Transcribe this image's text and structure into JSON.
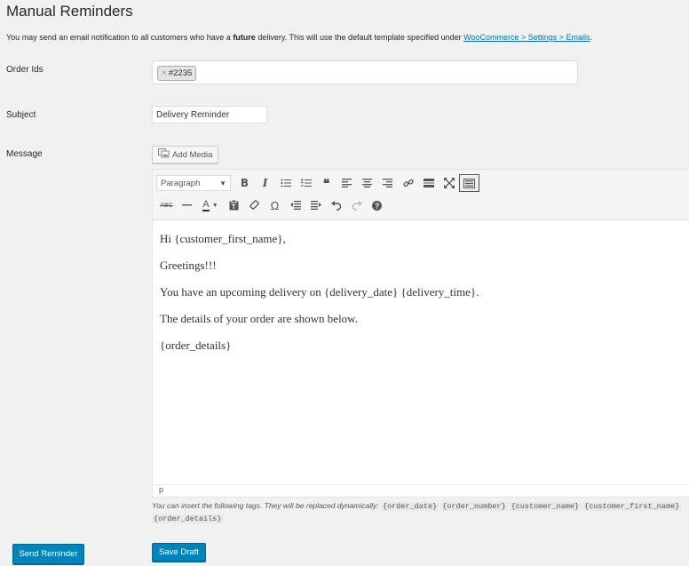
{
  "page": {
    "title": "Manual Reminders",
    "intro_prefix": "You may send an email notification to all customers who have a ",
    "intro_bold": "future",
    "intro_middle": " delivery. This will use the default template specified under ",
    "intro_link": "WooCommerce > Settings > Emails",
    "intro_suffix": "."
  },
  "form": {
    "order_ids_label": "Order Ids",
    "order_ids": [
      {
        "remove": "×",
        "value": "#2235"
      }
    ],
    "subject_label": "Subject",
    "subject_value": "Delivery Reminder",
    "message_label": "Message",
    "add_media_label": "Add Media"
  },
  "editor": {
    "format_select": "Paragraph",
    "toolbar_row1": [
      "bold-icon",
      "italic-icon",
      "bullet-list-icon",
      "numbered-list-icon",
      "blockquote-icon",
      "align-left-icon",
      "align-center-icon",
      "align-right-icon",
      "link-icon",
      "read-more-icon",
      "fullscreen-icon",
      "toolbar-toggle-icon"
    ],
    "toolbar_row2": [
      "strikethrough-icon",
      "horizontal-line-icon",
      "text-color-icon",
      "paste-text-icon",
      "clear-formatting-icon",
      "special-character-icon",
      "outdent-icon",
      "indent-icon",
      "undo-icon",
      "redo-icon",
      "help-icon"
    ],
    "content": [
      "Hi {customer_first_name},",
      "Greetings!!!",
      "You have an upcoming delivery on {delivery_date} {delivery_time}.",
      "The details of your order are shown below.",
      "{order_details}"
    ],
    "status_path": "p"
  },
  "hint": {
    "text": "You can insert the following tags. They will be replaced dynamically: ",
    "tags": [
      "{order_date}",
      "{order_number}",
      "{customer_name}",
      "{customer_first_name}",
      "{order_details}"
    ]
  },
  "buttons": {
    "send_reminder": "Send Reminder",
    "save_draft": "Save Draft"
  },
  "colors": {
    "primary": "#0085ba",
    "link": "#0073aa",
    "background": "#f1f1f1"
  }
}
